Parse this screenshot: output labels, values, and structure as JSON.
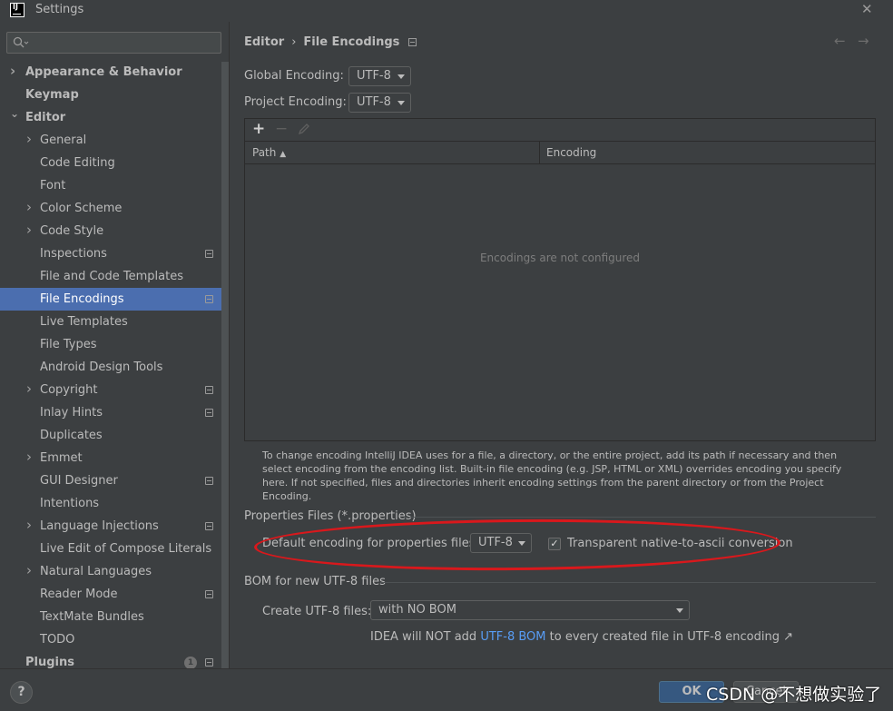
{
  "window": {
    "title": "Settings",
    "app_icon_text": "IJ",
    "close_icon": "close-icon"
  },
  "search": {
    "placeholder": "",
    "icon": "search-icon"
  },
  "sidebar": {
    "items": [
      {
        "label": "Appearance & Behavior",
        "bold": true,
        "arrow": "›",
        "level": 0
      },
      {
        "label": "Keymap",
        "bold": true,
        "arrow": "",
        "level": 0
      },
      {
        "label": "Editor",
        "bold": true,
        "arrow": "⌄",
        "level": 0
      },
      {
        "label": "General",
        "arrow": "›",
        "level": 1
      },
      {
        "label": "Code Editing",
        "arrow": "",
        "level": 1
      },
      {
        "label": "Font",
        "arrow": "",
        "level": 1
      },
      {
        "label": "Color Scheme",
        "arrow": "›",
        "level": 1
      },
      {
        "label": "Code Style",
        "arrow": "›",
        "level": 1
      },
      {
        "label": "Inspections",
        "arrow": "",
        "level": 1,
        "settings_icon": true
      },
      {
        "label": "File and Code Templates",
        "arrow": "",
        "level": 1
      },
      {
        "label": "File Encodings",
        "arrow": "",
        "level": 1,
        "settings_icon": true,
        "selected": true
      },
      {
        "label": "Live Templates",
        "arrow": "",
        "level": 1
      },
      {
        "label": "File Types",
        "arrow": "",
        "level": 1
      },
      {
        "label": "Android Design Tools",
        "arrow": "",
        "level": 1
      },
      {
        "label": "Copyright",
        "arrow": "›",
        "level": 1,
        "settings_icon": true
      },
      {
        "label": "Inlay Hints",
        "arrow": "",
        "level": 1,
        "settings_icon": true
      },
      {
        "label": "Duplicates",
        "arrow": "",
        "level": 1
      },
      {
        "label": "Emmet",
        "arrow": "›",
        "level": 1
      },
      {
        "label": "GUI Designer",
        "arrow": "",
        "level": 1,
        "settings_icon": true
      },
      {
        "label": "Intentions",
        "arrow": "",
        "level": 1
      },
      {
        "label": "Language Injections",
        "arrow": "›",
        "level": 1,
        "settings_icon": true
      },
      {
        "label": "Live Edit of Compose Literals",
        "arrow": "",
        "level": 1
      },
      {
        "label": "Natural Languages",
        "arrow": "›",
        "level": 1
      },
      {
        "label": "Reader Mode",
        "arrow": "",
        "level": 1,
        "settings_icon": true
      },
      {
        "label": "TextMate Bundles",
        "arrow": "",
        "level": 1
      },
      {
        "label": "TODO",
        "arrow": "",
        "level": 1
      },
      {
        "label": "Plugins",
        "bold": true,
        "arrow": "",
        "level": 0,
        "badge": "1",
        "settings_icon": true
      }
    ]
  },
  "breadcrumb": {
    "parent": "Editor",
    "separator": "›",
    "current": "File Encodings",
    "back_icon": "←",
    "forward_icon": "→"
  },
  "global_encoding": {
    "label": "Global Encoding:",
    "value": "UTF-8"
  },
  "project_encoding": {
    "label": "Project Encoding:",
    "value": "UTF-8"
  },
  "table": {
    "toolbar": {
      "add": "+",
      "remove": "−"
    },
    "columns": [
      "Path",
      "Encoding"
    ],
    "sort_indicator": "▲",
    "empty_text": "Encodings are not configured"
  },
  "help_text": "To change encoding IntelliJ IDEA uses for a file, a directory, or the entire project, add its path if necessary and then select encoding from the encoding list. Built-in file encoding (e.g. JSP, HTML or XML) overrides encoding you specify here. If not specified, files and directories inherit encoding settings from the parent directory or from the Project Encoding.",
  "properties": {
    "section_title": "Properties Files (*.properties)",
    "default_label": "Default encoding for properties files:",
    "default_value": "UTF-8",
    "transparent_checked": true,
    "transparent_label": "Transparent native-to-ascii conversion"
  },
  "bom": {
    "section_title": "BOM for new UTF-8 files",
    "create_label": "Create UTF-8 files:",
    "create_value": "with NO BOM",
    "hint_pre": "IDEA will NOT add ",
    "hint_link": "UTF-8 BOM",
    "hint_post": " to every created file in UTF-8 encoding ↗"
  },
  "footer": {
    "help": "?",
    "ok": "OK",
    "cancel": "Cancel",
    "watermark": "CSDN @不想做实验了"
  },
  "colors": {
    "background": "#3c3f41",
    "selection": "#4b6eaf",
    "link": "#589df6",
    "annotation": "#d9181c"
  }
}
